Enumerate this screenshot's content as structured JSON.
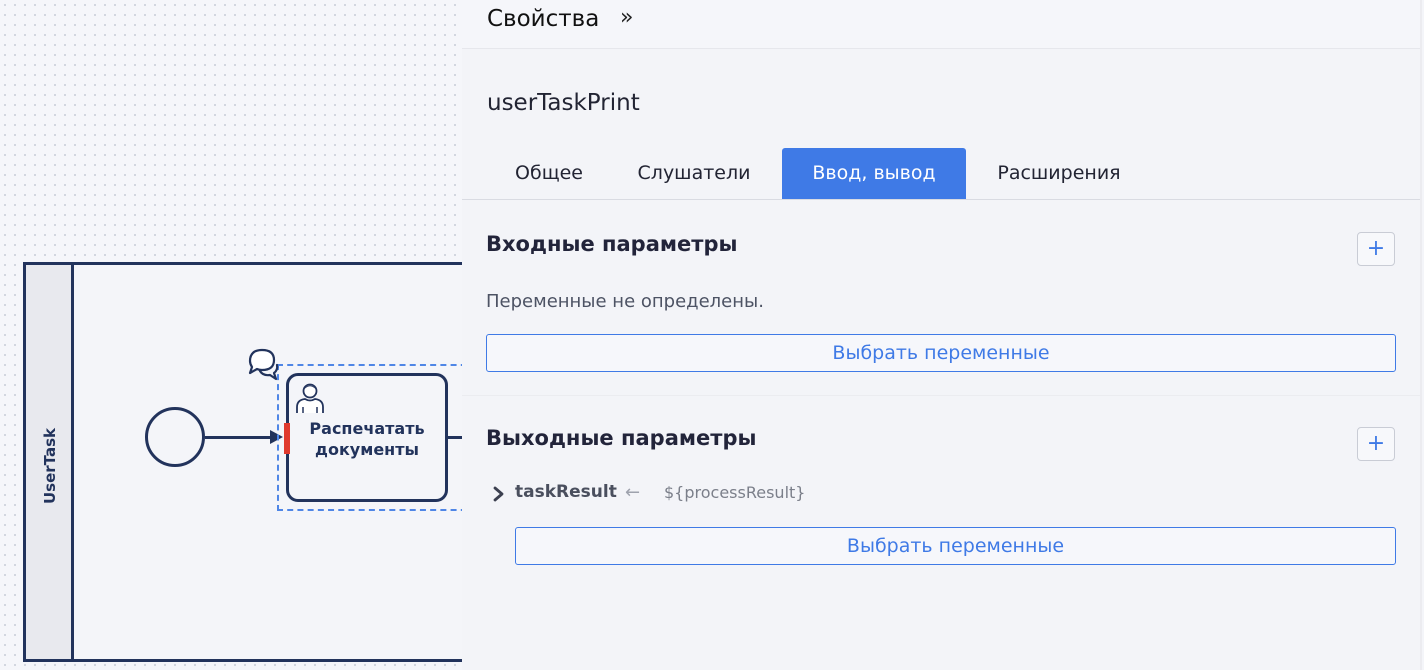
{
  "canvas": {
    "lane_label": "UserTask",
    "task_label_line1": "Распечатать",
    "task_label_line2": "документы"
  },
  "panel": {
    "title": "Свойства",
    "collapse_icon": "»",
    "element_name": "userTaskPrint",
    "tabs": [
      {
        "label": "Общее",
        "active": false
      },
      {
        "label": "Слушатели",
        "active": false
      },
      {
        "label": "Ввод, вывод",
        "active": true
      },
      {
        "label": "Расширения",
        "active": false
      }
    ],
    "input_section": {
      "title": "Входные параметры",
      "add_icon": "+",
      "empty_text": "Переменные не определены.",
      "select_button": "Выбрать переменные"
    },
    "output_section": {
      "title": "Выходные параметры",
      "add_icon": "+",
      "params": [
        {
          "name": "taskResult",
          "arrow": "←",
          "value": "${processResult}"
        }
      ],
      "select_button": "Выбрать переменные"
    }
  },
  "colors": {
    "accent": "#3f7ae6",
    "diagram_stroke": "#22335c",
    "marker_red": "#e03a2e"
  }
}
